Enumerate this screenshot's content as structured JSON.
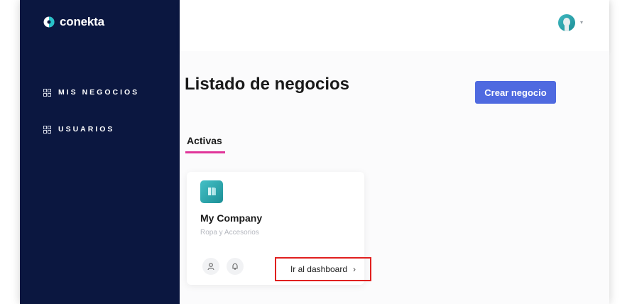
{
  "brand": {
    "name": "conekta"
  },
  "sidebar": {
    "items": [
      {
        "label": "MIS NEGOCIOS",
        "icon": "grid-icon"
      },
      {
        "label": "USUARIOS",
        "icon": "grid-icon"
      }
    ]
  },
  "header": {
    "avatar": "user-avatar",
    "caret": "▾"
  },
  "main": {
    "title": "Listado de negocios",
    "create_button": "Crear negocio",
    "tabs": [
      {
        "label": "Activas",
        "active": true
      }
    ],
    "businesses": [
      {
        "name": "My Company",
        "category": "Ropa y Accesorios",
        "dashboard_link": "Ir al dashboard",
        "chevron": "›"
      }
    ]
  },
  "colors": {
    "sidebar_bg": "#0b1740",
    "accent": "#4f6ae0",
    "tab_underline": "#e0359a",
    "highlight_box": "#e0201f",
    "company_icon": "#2aa6ad"
  }
}
